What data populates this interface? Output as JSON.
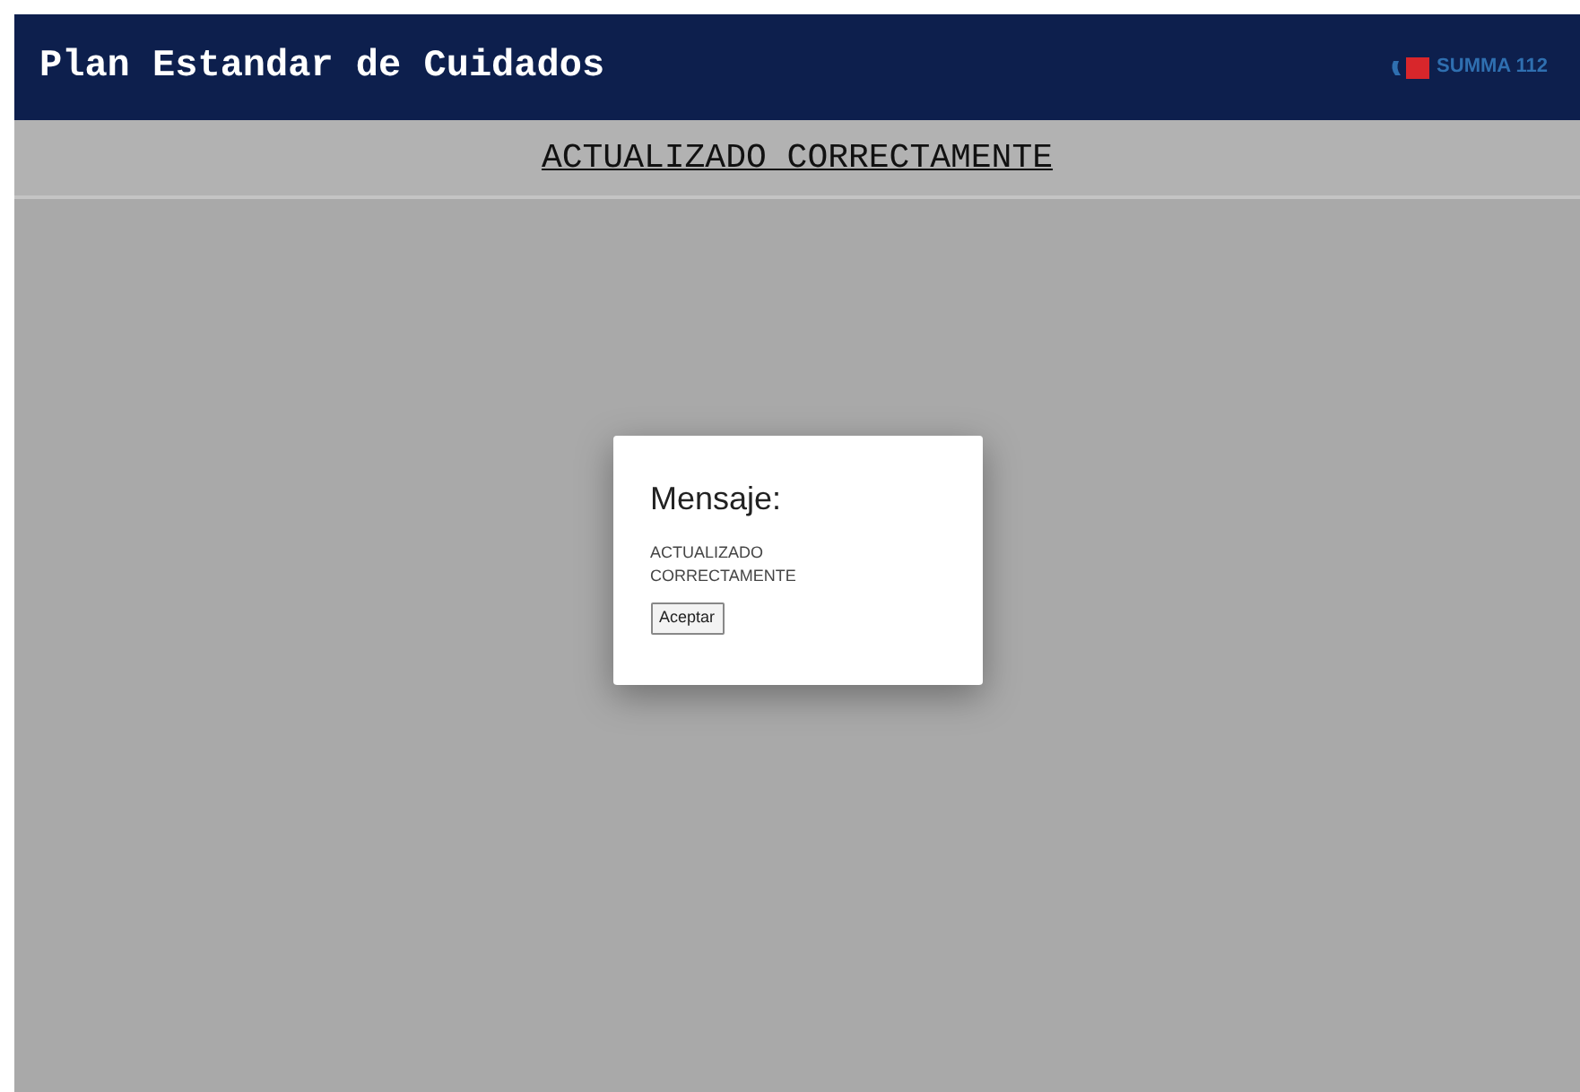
{
  "header": {
    "title": "Plan Estandar de Cuidados",
    "logo_text": "SUMMA 112"
  },
  "banner": {
    "text": "ACTUALIZADO CORRECTAMENTE"
  },
  "dialog": {
    "title": "Mensaje:",
    "message": "ACTUALIZADO CORRECTAMENTE",
    "button": "Aceptar"
  }
}
